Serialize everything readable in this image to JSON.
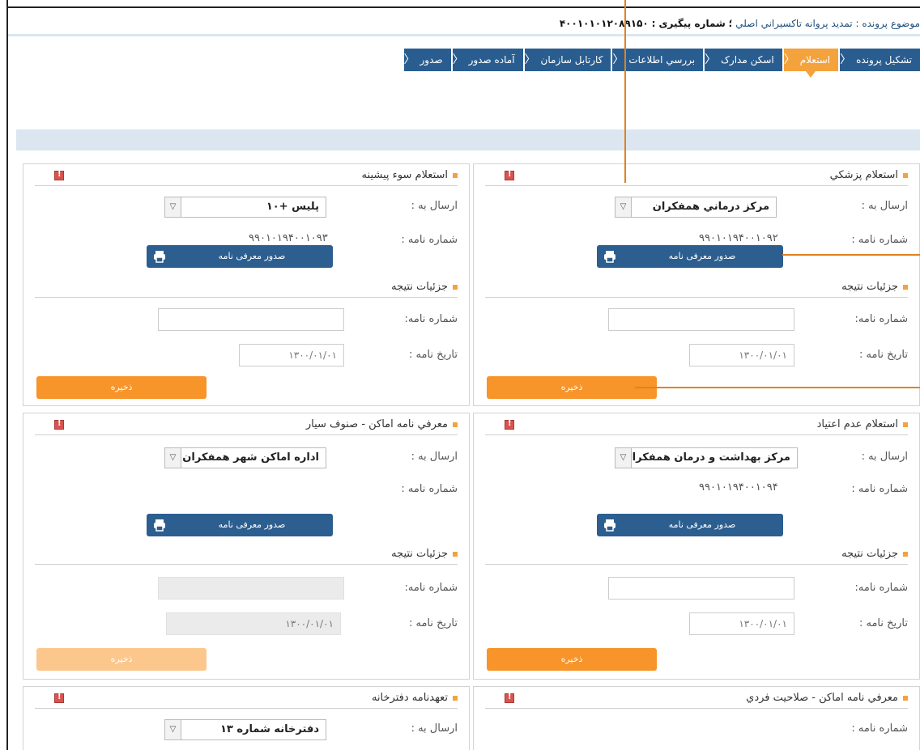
{
  "header": {
    "subject_label": "موضوع پرونده :",
    "subject_value": "تمدید پروانه تاکسيراني اصلي",
    "tracking_label": "شماره پیگیری :",
    "tracking_value": "۴۰۰۱۰۱۰۱۲۰۸۹۱۵۰"
  },
  "steps": [
    {
      "label": "تشکیل پرونده",
      "active": false
    },
    {
      "label": "استعلام",
      "active": true
    },
    {
      "label": "اسکن مدارک",
      "active": false
    },
    {
      "label": "بررسي اطلاعات",
      "active": false
    },
    {
      "label": "کارتابل سازمان",
      "active": false
    },
    {
      "label": "آماده صدور",
      "active": false
    },
    {
      "label": "صدور",
      "active": false
    }
  ],
  "colors": {
    "primary": "#2c5e90",
    "accent": "#f7942a",
    "band": "#dbe6f1",
    "close": "#d9534f"
  },
  "common": {
    "send_to_label": "ارسال به :",
    "letter_no_label": "شماره نامه :",
    "issue_btn": "صدور معرفی نامه",
    "result_title": "جزئیات نتیجه",
    "result_letter_no": "شماره نامه:",
    "letter_date_label": "تاریخ نامه :",
    "save_btn": "ذخیره",
    "date_value": "۱۳۰۰/۰۱/۰۱",
    "print_icon": "printer-icon",
    "close_icon": "error-icon",
    "dropdown_icon": "chevron-down-icon"
  },
  "panels": {
    "medical": {
      "title": "استعلام پزشکي",
      "send_to": "مرکز درماني همفکران",
      "letter_no": "۹۹۰۱۰۱۹۴۰۰۱۰۹۲"
    },
    "criminal": {
      "title": "استعلام سوء پیشینه",
      "send_to": "پلیس +۱۰",
      "letter_no": "۹۹۰۱۰۱۹۴۰۰۱۰۹۳"
    },
    "addiction": {
      "title": "استعلام عدم اعتیاد",
      "send_to": "مرکز بهداشت و درمان همفکران",
      "letter_no": "۹۹۰۱۰۱۹۴۰۰۱۰۹۴"
    },
    "places_mobile": {
      "title": "معرفي نامه اماكن - صنوف سیار",
      "send_to": "اداره اماکن شهر همفکران",
      "letter_no": ""
    },
    "places_personal": {
      "title": "معرفي نامه اماكن - صلاحیت فردي"
    },
    "notary": {
      "title": "تعهدنامه دفترخانه",
      "send_to": "دفترخانه شماره ۱۳"
    }
  }
}
